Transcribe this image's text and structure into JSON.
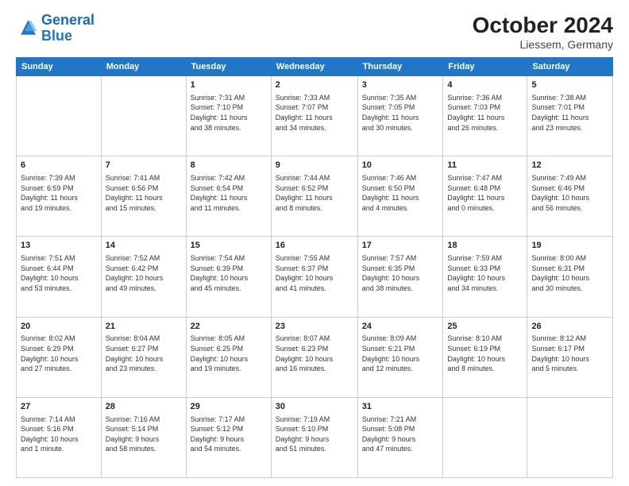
{
  "header": {
    "logo_general": "General",
    "logo_blue": "Blue",
    "title": "October 2024",
    "subtitle": "Liessem, Germany"
  },
  "days_of_week": [
    "Sunday",
    "Monday",
    "Tuesday",
    "Wednesday",
    "Thursday",
    "Friday",
    "Saturday"
  ],
  "weeks": [
    [
      {
        "day": "",
        "info": ""
      },
      {
        "day": "",
        "info": ""
      },
      {
        "day": "1",
        "info": "Sunrise: 7:31 AM\nSunset: 7:10 PM\nDaylight: 11 hours\nand 38 minutes."
      },
      {
        "day": "2",
        "info": "Sunrise: 7:33 AM\nSunset: 7:07 PM\nDaylight: 11 hours\nand 34 minutes."
      },
      {
        "day": "3",
        "info": "Sunrise: 7:35 AM\nSunset: 7:05 PM\nDaylight: 11 hours\nand 30 minutes."
      },
      {
        "day": "4",
        "info": "Sunrise: 7:36 AM\nSunset: 7:03 PM\nDaylight: 11 hours\nand 26 minutes."
      },
      {
        "day": "5",
        "info": "Sunrise: 7:38 AM\nSunset: 7:01 PM\nDaylight: 11 hours\nand 23 minutes."
      }
    ],
    [
      {
        "day": "6",
        "info": "Sunrise: 7:39 AM\nSunset: 6:59 PM\nDaylight: 11 hours\nand 19 minutes."
      },
      {
        "day": "7",
        "info": "Sunrise: 7:41 AM\nSunset: 6:56 PM\nDaylight: 11 hours\nand 15 minutes."
      },
      {
        "day": "8",
        "info": "Sunrise: 7:42 AM\nSunset: 6:54 PM\nDaylight: 11 hours\nand 11 minutes."
      },
      {
        "day": "9",
        "info": "Sunrise: 7:44 AM\nSunset: 6:52 PM\nDaylight: 11 hours\nand 8 minutes."
      },
      {
        "day": "10",
        "info": "Sunrise: 7:46 AM\nSunset: 6:50 PM\nDaylight: 11 hours\nand 4 minutes."
      },
      {
        "day": "11",
        "info": "Sunrise: 7:47 AM\nSunset: 6:48 PM\nDaylight: 11 hours\nand 0 minutes."
      },
      {
        "day": "12",
        "info": "Sunrise: 7:49 AM\nSunset: 6:46 PM\nDaylight: 10 hours\nand 56 minutes."
      }
    ],
    [
      {
        "day": "13",
        "info": "Sunrise: 7:51 AM\nSunset: 6:44 PM\nDaylight: 10 hours\nand 53 minutes."
      },
      {
        "day": "14",
        "info": "Sunrise: 7:52 AM\nSunset: 6:42 PM\nDaylight: 10 hours\nand 49 minutes."
      },
      {
        "day": "15",
        "info": "Sunrise: 7:54 AM\nSunset: 6:39 PM\nDaylight: 10 hours\nand 45 minutes."
      },
      {
        "day": "16",
        "info": "Sunrise: 7:55 AM\nSunset: 6:37 PM\nDaylight: 10 hours\nand 41 minutes."
      },
      {
        "day": "17",
        "info": "Sunrise: 7:57 AM\nSunset: 6:35 PM\nDaylight: 10 hours\nand 38 minutes."
      },
      {
        "day": "18",
        "info": "Sunrise: 7:59 AM\nSunset: 6:33 PM\nDaylight: 10 hours\nand 34 minutes."
      },
      {
        "day": "19",
        "info": "Sunrise: 8:00 AM\nSunset: 6:31 PM\nDaylight: 10 hours\nand 30 minutes."
      }
    ],
    [
      {
        "day": "20",
        "info": "Sunrise: 8:02 AM\nSunset: 6:29 PM\nDaylight: 10 hours\nand 27 minutes."
      },
      {
        "day": "21",
        "info": "Sunrise: 8:04 AM\nSunset: 6:27 PM\nDaylight: 10 hours\nand 23 minutes."
      },
      {
        "day": "22",
        "info": "Sunrise: 8:05 AM\nSunset: 6:25 PM\nDaylight: 10 hours\nand 19 minutes."
      },
      {
        "day": "23",
        "info": "Sunrise: 8:07 AM\nSunset: 6:23 PM\nDaylight: 10 hours\nand 16 minutes."
      },
      {
        "day": "24",
        "info": "Sunrise: 8:09 AM\nSunset: 6:21 PM\nDaylight: 10 hours\nand 12 minutes."
      },
      {
        "day": "25",
        "info": "Sunrise: 8:10 AM\nSunset: 6:19 PM\nDaylight: 10 hours\nand 8 minutes."
      },
      {
        "day": "26",
        "info": "Sunrise: 8:12 AM\nSunset: 6:17 PM\nDaylight: 10 hours\nand 5 minutes."
      }
    ],
    [
      {
        "day": "27",
        "info": "Sunrise: 7:14 AM\nSunset: 5:16 PM\nDaylight: 10 hours\nand 1 minute."
      },
      {
        "day": "28",
        "info": "Sunrise: 7:16 AM\nSunset: 5:14 PM\nDaylight: 9 hours\nand 58 minutes."
      },
      {
        "day": "29",
        "info": "Sunrise: 7:17 AM\nSunset: 5:12 PM\nDaylight: 9 hours\nand 54 minutes."
      },
      {
        "day": "30",
        "info": "Sunrise: 7:19 AM\nSunset: 5:10 PM\nDaylight: 9 hours\nand 51 minutes."
      },
      {
        "day": "31",
        "info": "Sunrise: 7:21 AM\nSunset: 5:08 PM\nDaylight: 9 hours\nand 47 minutes."
      },
      {
        "day": "",
        "info": ""
      },
      {
        "day": "",
        "info": ""
      }
    ]
  ]
}
